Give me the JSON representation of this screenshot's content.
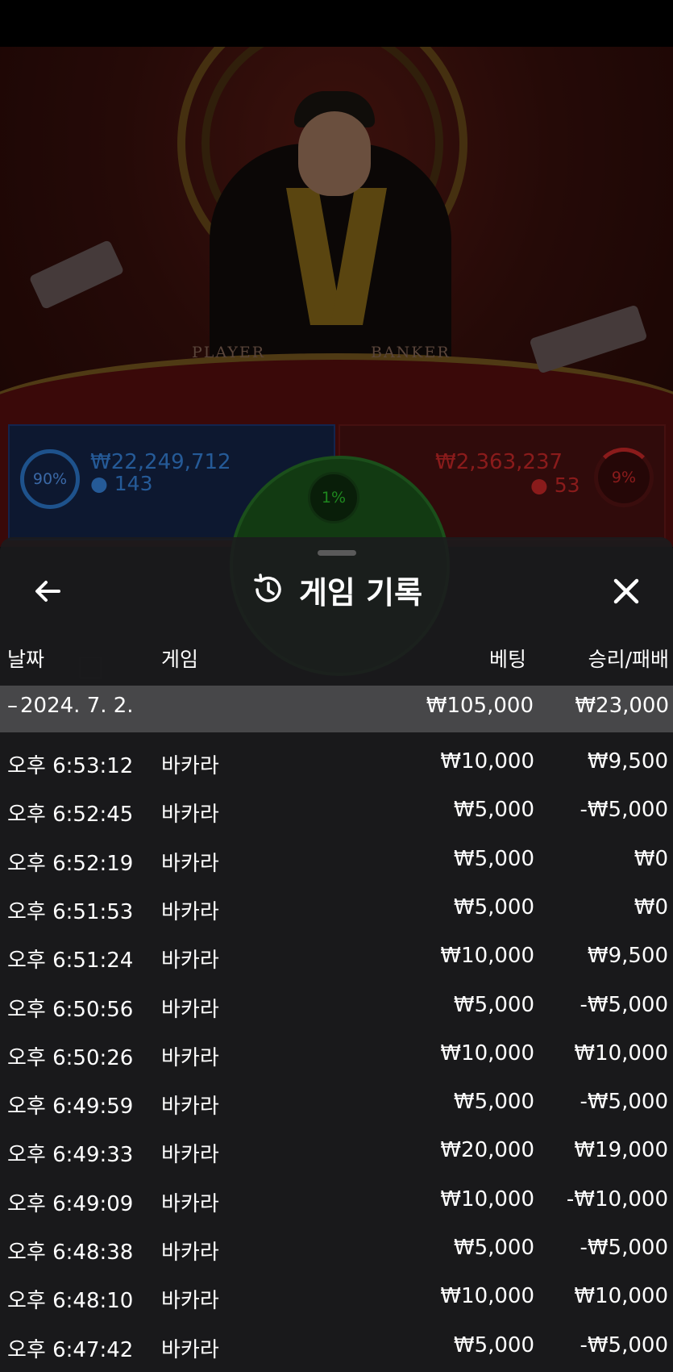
{
  "stream": {
    "table_labels": {
      "player": "PLAYER",
      "banker": "BANKER"
    }
  },
  "bets": {
    "player": {
      "percent": "90%",
      "amount": "₩22,249,712",
      "count": "143",
      "color": "#2f7fd8"
    },
    "tie": {
      "percent": "1%",
      "color": "#2fb52f"
    },
    "banker": {
      "percent": "9%",
      "amount": "₩2,363,237",
      "count": "53",
      "color": "#d42a2a"
    }
  },
  "sheet": {
    "title": "게임 기록",
    "back_icon": "arrow-left-icon",
    "history_icon": "history-clock-icon",
    "close_icon": "close-icon",
    "columns": {
      "date": "날짜",
      "game": "게임",
      "bet": "베팅",
      "result": "승리/패배"
    },
    "date_group": {
      "date": "2024. 7. 2.",
      "bet_total": "₩105,000",
      "result_total": "₩23,000"
    },
    "rows": [
      {
        "time": "오후 6:53:12",
        "game": "바카라",
        "bet": "₩10,000",
        "result": "₩9,500"
      },
      {
        "time": "오후 6:52:45",
        "game": "바카라",
        "bet": "₩5,000",
        "result": "-₩5,000"
      },
      {
        "time": "오후 6:52:19",
        "game": "바카라",
        "bet": "₩5,000",
        "result": "₩0"
      },
      {
        "time": "오후 6:51:53",
        "game": "바카라",
        "bet": "₩5,000",
        "result": "₩0"
      },
      {
        "time": "오후 6:51:24",
        "game": "바카라",
        "bet": "₩10,000",
        "result": "₩9,500"
      },
      {
        "time": "오후 6:50:56",
        "game": "바카라",
        "bet": "₩5,000",
        "result": "-₩5,000"
      },
      {
        "time": "오후 6:50:26",
        "game": "바카라",
        "bet": "₩10,000",
        "result": "₩10,000"
      },
      {
        "time": "오후 6:49:59",
        "game": "바카라",
        "bet": "₩5,000",
        "result": "-₩5,000"
      },
      {
        "time": "오후 6:49:33",
        "game": "바카라",
        "bet": "₩20,000",
        "result": "₩19,000"
      },
      {
        "time": "오후 6:49:09",
        "game": "바카라",
        "bet": "₩10,000",
        "result": "-₩10,000"
      },
      {
        "time": "오후 6:48:38",
        "game": "바카라",
        "bet": "₩5,000",
        "result": "-₩5,000"
      },
      {
        "time": "오후 6:48:10",
        "game": "바카라",
        "bet": "₩10,000",
        "result": "₩10,000"
      },
      {
        "time": "오후 6:47:42",
        "game": "바카라",
        "bet": "₩5,000",
        "result": "-₩5,000"
      }
    ]
  }
}
